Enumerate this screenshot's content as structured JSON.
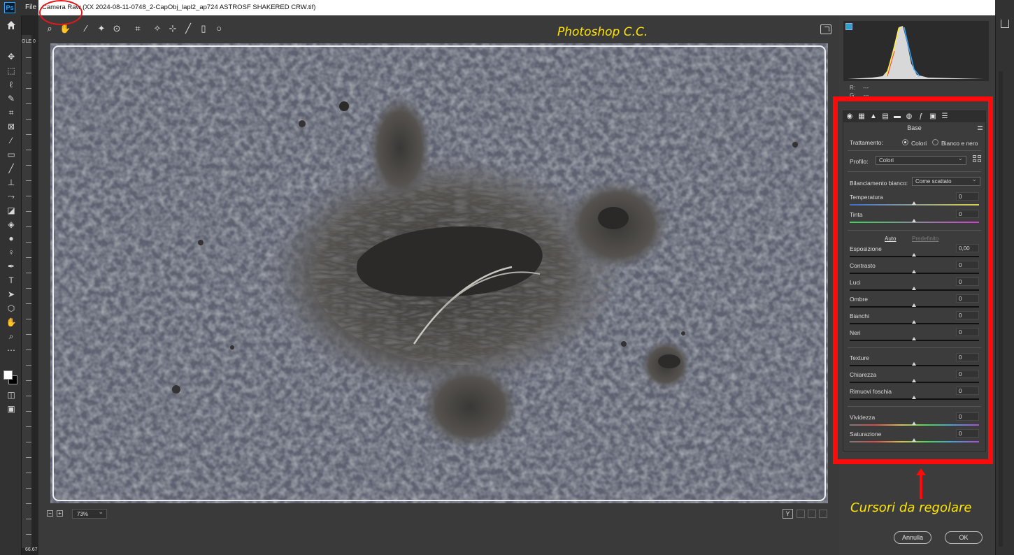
{
  "app": {
    "logo_text": "Ps",
    "menu_file": "File"
  },
  "dialog": {
    "title": "Camera Raw (XX 2024-08-11-0748_2-CapObj_lapl2_ap724 ASTROSF SHAKERED CRW.tif)"
  },
  "annotation": {
    "top_label": "Photoshop C.C.",
    "bottom_label": "Cursori da regolare",
    "accent_color": "#ffe600",
    "highlight_color": "#ff0a0a"
  },
  "ps_doc_tab": "OLE 0",
  "ps_zoom": "66.67",
  "zoom": {
    "value": "73%"
  },
  "view_mode": "Y",
  "histogram": {
    "r_label": "R:",
    "r_value": "---",
    "g_label": "G:",
    "g_value": "---"
  },
  "basic": {
    "title": "Base",
    "treatment_label": "Trattamento:",
    "treatment_options": [
      "Colori",
      "Bianco e nero"
    ],
    "treatment_selected": "Colori",
    "profile_label": "Profilo:",
    "profile_value": "Colori",
    "wb_label": "Bilanciamento bianco:",
    "wb_value": "Come scattato",
    "auto_link": "Auto",
    "default_link": "Predefinito",
    "sliders": {
      "temperatura": {
        "label": "Temperatura",
        "value": "0"
      },
      "tinta": {
        "label": "Tinta",
        "value": "0"
      },
      "esposizione": {
        "label": "Esposizione",
        "value": "0,00"
      },
      "contrasto": {
        "label": "Contrasto",
        "value": "0"
      },
      "luci": {
        "label": "Luci",
        "value": "0"
      },
      "ombre": {
        "label": "Ombre",
        "value": "0"
      },
      "bianchi": {
        "label": "Bianchi",
        "value": "0"
      },
      "neri": {
        "label": "Neri",
        "value": "0"
      },
      "texture": {
        "label": "Texture",
        "value": "0"
      },
      "chiarezza": {
        "label": "Chiarezza",
        "value": "0"
      },
      "foschia": {
        "label": "Rimuovi foschia",
        "value": "0"
      },
      "vividezza": {
        "label": "Vividezza",
        "value": "0"
      },
      "saturazione": {
        "label": "Saturazione",
        "value": "0"
      }
    }
  },
  "buttons": {
    "cancel": "Annulla",
    "ok": "OK"
  }
}
